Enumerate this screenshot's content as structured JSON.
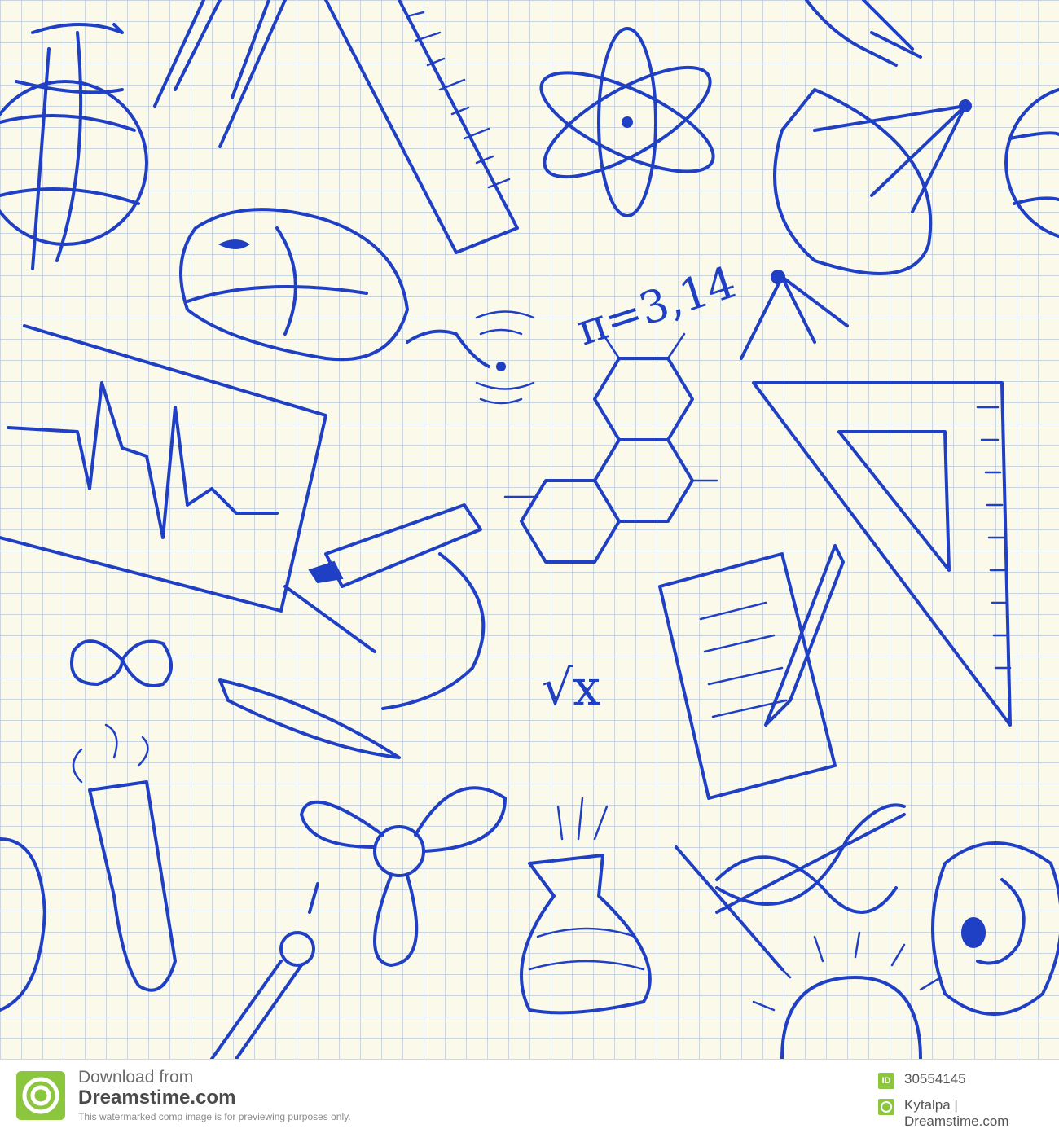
{
  "colors": {
    "ink": "#1f3fc4",
    "paper": "#fbf9ea",
    "grid": "#b7c8dd",
    "footer_bg": "#ffffff",
    "logo_green": "#8cc63f"
  },
  "doodles": {
    "pi_formula": "π=3,14",
    "sqrt_label": "√x"
  },
  "footer": {
    "download_line1": "Download from",
    "download_line2": "Dreamstime.com",
    "note": "This watermarked comp image is for previewing purposes only.",
    "id_badge": "ID",
    "id_number": "30554145",
    "author": "Kytalpa | Dreamstime.com"
  }
}
